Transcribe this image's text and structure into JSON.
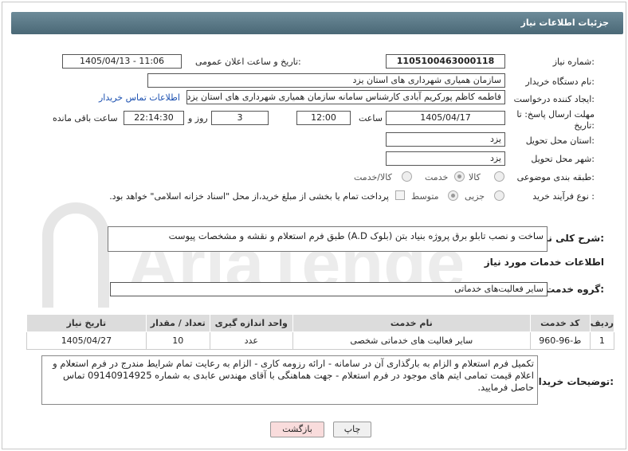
{
  "header": {
    "title": "جزئیات اطلاعات نیاز"
  },
  "need_number": {
    "label": "شماره نیاز:",
    "value": "1105100463000118"
  },
  "announce_date": {
    "label": "تاریخ و ساعت اعلان عمومی:",
    "value": "1405/04/13 - 11:06"
  },
  "buyer_org": {
    "label": "نام دستگاه خریدار:",
    "value": "سازمان همیاری شهرداری های استان یزد"
  },
  "requester": {
    "label": "ایجاد کننده درخواست:",
    "value": "فاطمه کاظم پورکریم آبادی کارشناس سامانه سازمان همیاری شهرداری های استان یزد",
    "contact_link": "اطلاعات تماس خریدار"
  },
  "deadline": {
    "label1": "مهلت ارسال پاسخ: تا",
    "label2": "تاریخ:",
    "date": "1405/04/17",
    "time_label": "ساعت",
    "time": "12:00",
    "days": "3",
    "days_label": "روز و",
    "remaining": "22:14:30",
    "remaining_label": "ساعت باقی مانده"
  },
  "delivery_province": {
    "label": "استان محل تحویل:",
    "value": "یزد"
  },
  "delivery_city": {
    "label": "شهر محل تحویل:",
    "value": "یزد"
  },
  "category": {
    "label": "طبقه بندی موضوعی:",
    "options": [
      "کالا",
      "خدمت",
      "کالا/خدمت"
    ],
    "selected": "خدمت"
  },
  "process_type": {
    "label": "نوع فرآیند خرید :",
    "options": [
      "جزیی",
      "متوسط"
    ],
    "selected": "متوسط",
    "note": "پرداخت تمام یا بخشی از مبلغ خرید،از محل \"اسناد خزانه اسلامی\" خواهد بود."
  },
  "description": {
    "label": "شرح کلی نیاز:",
    "value": "ساخت و نصب تابلو برق پروژه بنیاد بتن (بلوک A.D) طبق فرم استعلام و نقشه و مشخصات پیوست"
  },
  "services_title": "اطلاعات خدمات مورد نیاز",
  "service_group": {
    "label": "گروه خدمت:",
    "value": "سایر فعالیت‌های خدماتی"
  },
  "table": {
    "headers": [
      "ردیف",
      "کد خدمت",
      "نام خدمت",
      "واحد اندازه گیری",
      "تعداد / مقدار",
      "تاریخ نیاز"
    ],
    "rows": [
      [
        "1",
        "ط-96-960",
        "سایر فعالیت های خدماتی شخصی",
        "عدد",
        "10",
        "1405/04/27"
      ]
    ]
  },
  "buyer_notes": {
    "label": "توضیحات خریدار:",
    "value": "تکمیل فرم استعلام و الزام به بارگذاری آن در سامانه - ارائه رزومه کاری - الزام به رعایت تمام شرایط مندرج در فرم استعلام و اعلام قیمت تمامی ایتم های موجود در فرم استعلام - جهت هماهنگی با آقای مهندس عابدی به شماره 09140914925 تماس حاصل فرمایید."
  },
  "buttons": {
    "print": "چاپ",
    "back": "بازگشت"
  },
  "watermark_text": "AriaTender.net",
  "colors": {
    "header": "#5a7886",
    "link": "#1a4fb0",
    "back_button": "#f9dcdc"
  }
}
